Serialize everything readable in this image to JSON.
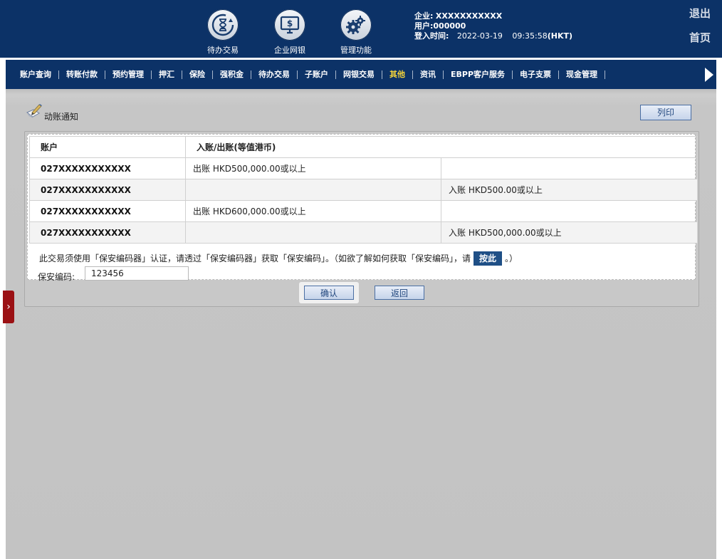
{
  "header": {
    "icons": [
      {
        "label": "待办交易",
        "icon": "hourglass-icon"
      },
      {
        "label": "企业网银",
        "icon": "monitor-dollar-icon"
      },
      {
        "label": "管理功能",
        "icon": "gears-icon"
      }
    ],
    "company_label": "企业:",
    "company_value": "XXXXXXXXXXX",
    "user_label": "用户:",
    "user_value": "000000",
    "login_label": "登入时间:",
    "login_date": "2022-03-19",
    "login_time": "09:35:58",
    "login_tz": "(HKT)",
    "logout": "退出",
    "home": "首页"
  },
  "nav": {
    "items": [
      "账户查询",
      "转账付款",
      "预约管理",
      "押汇",
      "保险",
      "强积金",
      "待办交易",
      "子账户",
      "网银交易",
      "其他",
      "资讯",
      "EBPP客户服务",
      "电子支票",
      "现金管理"
    ],
    "active_index": 9
  },
  "page": {
    "title": "动账通知",
    "print_label": "列印",
    "table": {
      "headers": [
        "账户",
        "入账/出账(等值港币)"
      ],
      "rows": [
        {
          "account": "027XXXXXXXXXXX",
          "debit": "出账 HKD500,000.00或以上",
          "credit": ""
        },
        {
          "account": "027XXXXXXXXXXX",
          "debit": "",
          "credit": "入账 HKD500.00或以上"
        },
        {
          "account": "027XXXXXXXXXXX",
          "debit": "出账 HKD600,000.00或以上",
          "credit": ""
        },
        {
          "account": "027XXXXXXXXXXX",
          "debit": "",
          "credit": "入账 HKD500,000.00或以上"
        }
      ]
    },
    "note_before": "此交易须使用「保安编码器」认证，请透过「保安编码器」获取「保安编码」。（如欲了解如何获取「保安编码」，请",
    "note_button": "按此",
    "note_after": "。）",
    "security_code_label": "保安编码:",
    "security_code_value": "123456",
    "confirm_label": "确认",
    "back_label": "返回"
  },
  "colors": {
    "header_bg": "#0c3267",
    "active_nav": "#f5d43a",
    "page_bg": "#c3c3c3",
    "side_tab": "#9b1114"
  }
}
